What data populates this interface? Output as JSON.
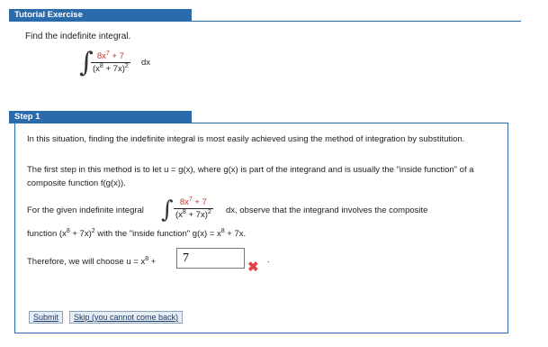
{
  "tutorial": {
    "header": "Tutorial Exercise",
    "prompt": "Find the indefinite integral.",
    "integrand_num": "8x",
    "integrand_num_exp": "7",
    "integrand_num_rest": " + 7",
    "integrand_den": "(x",
    "integrand_den_exp": "8",
    "integrand_den_rest": " + 7x)",
    "integrand_den_exp2": "2",
    "dx": "dx"
  },
  "step1": {
    "header": "Step 1",
    "para1": "In this situation, finding the indefinite integral is most easily achieved using the method of integration by substitution.",
    "para2": "The first step in this method is to let u = g(x), where g(x) is part of the integrand and is usually the \"inside function\" of a composite function f(g(x)).",
    "para3_prefix": "For the given indefinite integral",
    "para3_suffix": "dx,  observe that the integrand involves the composite",
    "para4_prefix": "function (x",
    "para4_exp": "8",
    "para4_mid": " + 7x)",
    "para4_exp2": "2",
    "para4_suffix": " with the \"inside function\" g(x) = x",
    "para4_exp3": "8",
    "para4_end": " + 7x.",
    "choose_prefix": "Therefore, we will choose u = x",
    "choose_exp": "8",
    "choose_plus": " +",
    "answer_value": "7",
    "answer_period": ".",
    "submit_label": "Submit",
    "skip_label": "Skip (you cannot come back)"
  },
  "colors": {
    "header_bg": "#2b6aab",
    "highlight": "#c0392b",
    "error": "#e0444a"
  },
  "icons": {
    "incorrect": "x-mark-icon"
  }
}
